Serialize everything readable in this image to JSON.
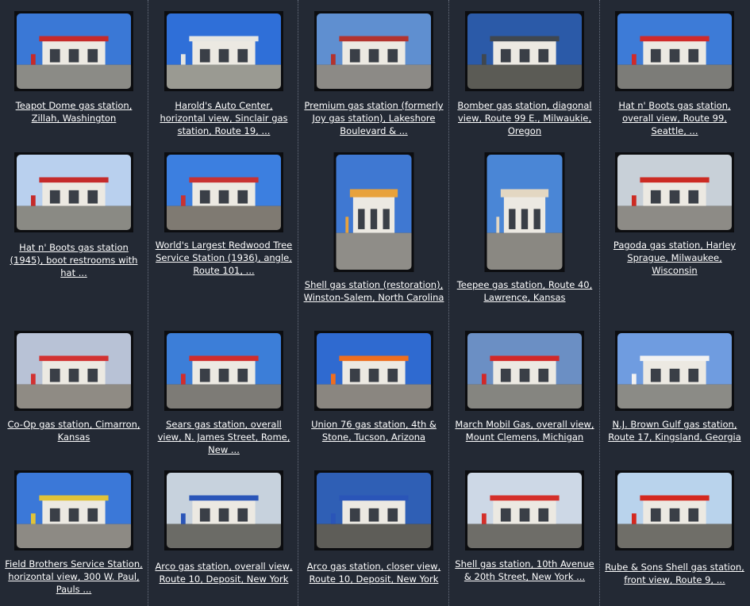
{
  "gallery": {
    "rows": [
      [
        {
          "caption": "Teapot Dome gas station, Zillah, Washington",
          "thumb": "teapot",
          "sky": "#3a78d6",
          "ground": "#8b8b86",
          "accent": "#c62a2a"
        },
        {
          "caption": "Harold's Auto Center, horizontal view, Sinclair gas station, Route 19, ...",
          "thumb": "dino",
          "sky": "#2f6fd8",
          "ground": "#9a9a92",
          "accent": "#e6e6e2"
        },
        {
          "caption": "Premium gas station (formerly Joy gas station), Lakeshore Boulevard & ...",
          "thumb": "castle",
          "sky": "#5f8fd0",
          "ground": "#8c8a86",
          "accent": "#b3332e"
        },
        {
          "caption": "Bomber gas station, diagonal view, Route 99 E., Milwaukie, Oregon",
          "thumb": "bomber",
          "sky": "#2b5aa8",
          "ground": "#5b5b55",
          "accent": "#3f4750"
        },
        {
          "caption": "Hat n' Boots gas station, overall view, Route 99, Seattle, ...",
          "thumb": "hat",
          "sky": "#3d7bd7",
          "ground": "#7c7c78",
          "accent": "#d02a2a"
        }
      ],
      [
        {
          "caption": "Hat n' Boots gas station (1945), boot restrooms with hat ...",
          "thumb": "boots",
          "sky": "#b9d0ee",
          "ground": "#8a8a84",
          "accent": "#c52b2b"
        },
        {
          "caption": "World's Largest Redwood Tree Service Station (1936), angle, Route 101, ...",
          "thumb": "redwood",
          "sky": "#3c7fe0",
          "ground": "#7f7a72",
          "accent": "#c83232"
        },
        {
          "caption": "Shell gas station (restoration), Winston-Salem, North Carolina",
          "thumb": "shell",
          "sky": "#3f78d2",
          "ground": "#8f8d88",
          "accent": "#e8a23c"
        },
        {
          "caption": "Teepee gas station, Route 40, Lawrence, Kansas",
          "thumb": "teepee",
          "sky": "#4a86d6",
          "ground": "#8a8882",
          "accent": "#e3d7c2"
        },
        {
          "caption": "Pagoda gas station, Harley Sprague, Milwaukee, Wisconsin",
          "thumb": "pagoda",
          "sky": "#c8d0d8",
          "ground": "#8d8b86",
          "accent": "#cc2b23"
        }
      ],
      [
        {
          "caption": "Co-Op gas station, Cimarron, Kansas",
          "thumb": "coop",
          "sky": "#b8c2d6",
          "ground": "#8f8b84",
          "accent": "#d23232"
        },
        {
          "caption": "Sears gas station, overall view, N. James Street, Rome, New ...",
          "thumb": "sears",
          "sky": "#3c7ed8",
          "ground": "#7d7b76",
          "accent": "#d12d2d"
        },
        {
          "caption": "Union 76 gas station, 4th & Stone, Tucson, Arizona",
          "thumb": "union",
          "sky": "#2f6ad0",
          "ground": "#8a8680",
          "accent": "#ee6e1f"
        },
        {
          "caption": "March Mobil Gas, overall view, Mount Clemens, Michigan",
          "thumb": "mobil",
          "sky": "#6b8fc4",
          "ground": "#858580",
          "accent": "#d22828"
        },
        {
          "caption": "N.J. Brown Gulf gas station, Route 17, Kingsland, Georgia",
          "thumb": "gulf",
          "sky": "#6f9ce0",
          "ground": "#8b8b86",
          "accent": "#f2f2f2"
        }
      ],
      [
        {
          "caption": "Field Brothers Service Station, horizontal view, 300 W. Paul, Pauls ...",
          "thumb": "field",
          "sky": "#3b78d8",
          "ground": "#8d8a84",
          "accent": "#e0c33a"
        },
        {
          "caption": "Arco gas station, overall view, Route 10, Deposit, New York",
          "thumb": "arco1",
          "sky": "#c7d2dd",
          "ground": "#6b6b66",
          "accent": "#2a55b8"
        },
        {
          "caption": "Arco gas station, closer view, Route 10, Deposit, New York",
          "thumb": "arco2",
          "sky": "#2f5fb5",
          "ground": "#5e5d58",
          "accent": "#2a55b8"
        },
        {
          "caption": "Shell gas station, 10th Avenue & 20th Street, New York ...",
          "thumb": "shellny",
          "sky": "#cdd8e6",
          "ground": "#6e6d68",
          "accent": "#d42f2a"
        },
        {
          "caption": "Rube & Sons Shell gas station, front view, Route 9, ...",
          "thumb": "rube",
          "sky": "#b9d3ec",
          "ground": "#6f6e68",
          "accent": "#d4281f"
        }
      ]
    ]
  }
}
